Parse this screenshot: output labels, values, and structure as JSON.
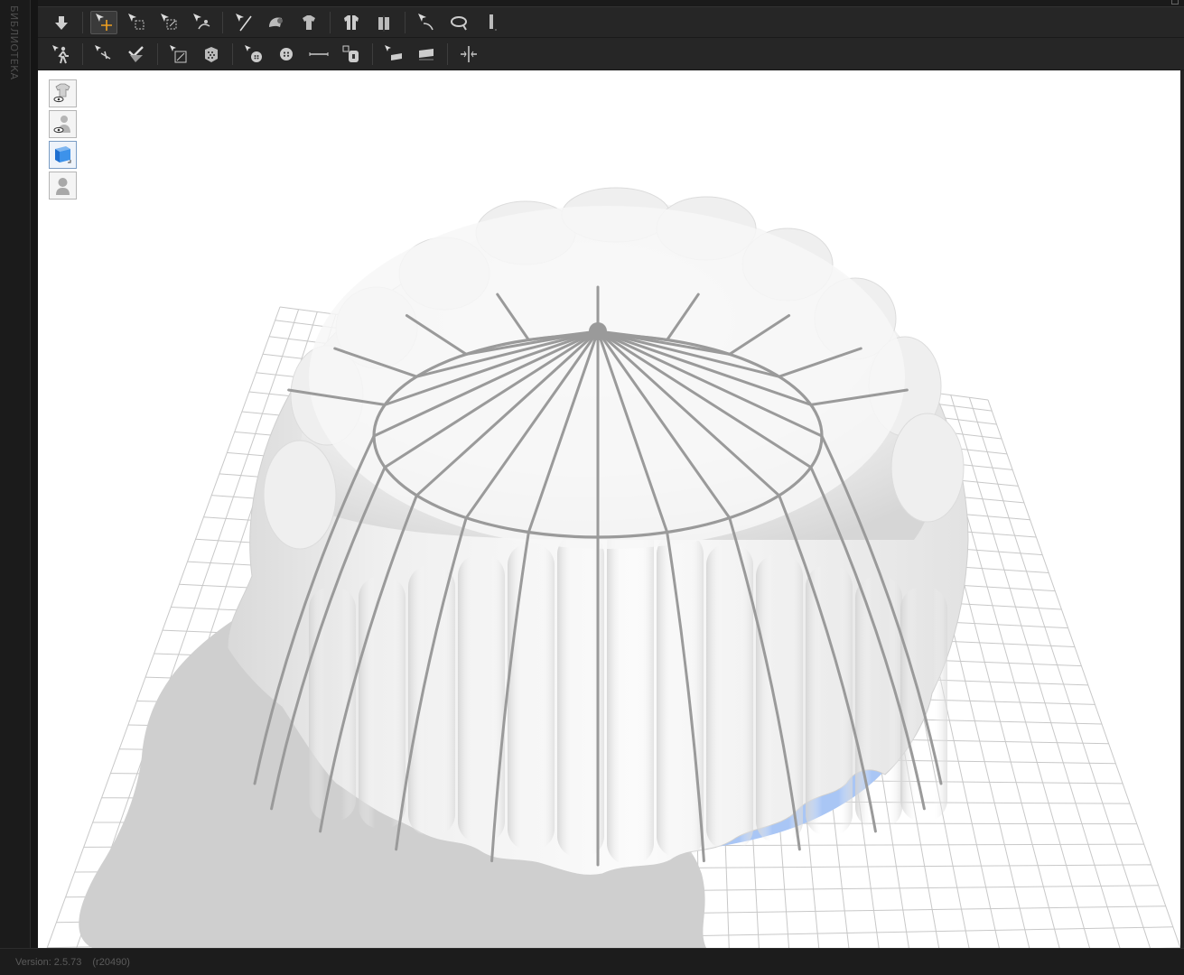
{
  "sidebar": {
    "library_label": "БИБЛИОТЕКА"
  },
  "toolbar_top": {
    "tools": [
      "download-arrow-icon",
      "select-move-icon",
      "select-box-icon",
      "transform-pattern-icon",
      "edit-curve-icon",
      "draw-line-icon",
      "fold-arrangement-icon",
      "garment-arrangement-icon",
      "symmetry-avatar-icon",
      "avatar-measure-icon",
      "tack-icon",
      "zipper-ring-icon",
      "ruler-icon"
    ],
    "active_tool": "select-move-icon"
  },
  "toolbar_bottom": {
    "tools": [
      "select-avatar-icon",
      "pin-icon",
      "check-fabric-icon",
      "puckering-icon",
      "texture-icon",
      "button-add-icon",
      "button-icon",
      "topstitch-line-icon",
      "lock-icon",
      "graphic-icon",
      "select-graphic-icon",
      "measure-split-icon"
    ]
  },
  "display_modes": [
    {
      "icon": "garment-visibility-icon",
      "active": false
    },
    {
      "icon": "avatar-visibility-icon",
      "active": false
    },
    {
      "icon": "fabric-texture-icon",
      "active": true
    },
    {
      "icon": "avatar-silhouette-icon",
      "active": false
    }
  ],
  "status": {
    "version": "Version: 2.5.73",
    "revision": "(r20490)"
  },
  "colors": {
    "ui_dark": "#262626",
    "viewport_bg": "#ffffff",
    "grid": "#c8c8c8",
    "shadow": "#cfcfcf",
    "fabric": "#f2f2f2",
    "seam": "#9a9a9a",
    "accent_blue": "#a9c6f5"
  }
}
